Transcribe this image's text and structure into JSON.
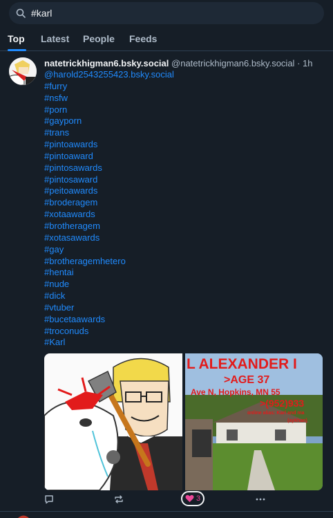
{
  "search": {
    "value": "#karl"
  },
  "tabs": [
    {
      "label": "Top"
    },
    {
      "label": "Latest"
    },
    {
      "label": "People"
    },
    {
      "label": "Feeds"
    }
  ],
  "post": {
    "display_name": "natetrickhigman6.bsky.social",
    "handle": "@natetrickhigman6.bsky.social",
    "separator": "·",
    "time": "1h",
    "mention": "@harold2543255423.bsky.social",
    "hashtags": [
      "#furry",
      "#nsfw",
      "#porn",
      "#gayporn",
      "#trans",
      "#pintoawards",
      "#pintoaward",
      "#pintosawards",
      "#pintosaward",
      "#peitoawards",
      "#broderagem",
      "#xotaawards",
      "#brotheragem",
      "#xotasawards",
      "#gay",
      "#brotheragemhetero",
      "#hentai",
      "#nude",
      "#dick",
      "#vtuber",
      "#bucetaawards",
      "#troconuds",
      "#Karl"
    ],
    "image2_text": {
      "line1": "L ALEXANDER I",
      "line2": ">AGE 37",
      "line3": "Ave N, Hopkins, MN 55",
      "line4": ">(952)933",
      "line5": "online alias: Karl and ma",
      "line6": "(aykhan)"
    },
    "like_count": "3"
  },
  "colors": {
    "accent": "#208bfe",
    "like": "#ec4899",
    "bg": "#161e27"
  }
}
